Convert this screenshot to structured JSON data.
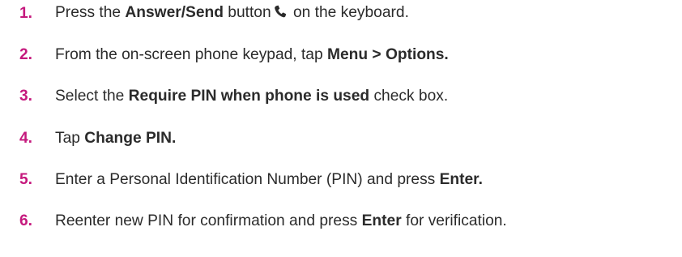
{
  "accent_color": "#c5197d",
  "steps": [
    {
      "number": "1.",
      "parts": [
        "Press the ",
        "Answer/Send",
        " button",
        " on the keyboard."
      ],
      "icon": "phone-icon"
    },
    {
      "number": "2.",
      "parts": [
        "From the on-screen phone keypad, tap ",
        "Menu > Options."
      ]
    },
    {
      "number": "3.",
      "parts": [
        "Select the ",
        "Require PIN when phone is used",
        " check box."
      ]
    },
    {
      "number": "4.",
      "parts": [
        "Tap ",
        "Change PIN."
      ]
    },
    {
      "number": "5.",
      "parts": [
        "Enter a Personal Identification Number (PIN) and press ",
        "Enter."
      ]
    },
    {
      "number": "6.",
      "parts": [
        "Reenter new PIN for confirmation and press ",
        "Enter",
        " for verification."
      ]
    }
  ]
}
